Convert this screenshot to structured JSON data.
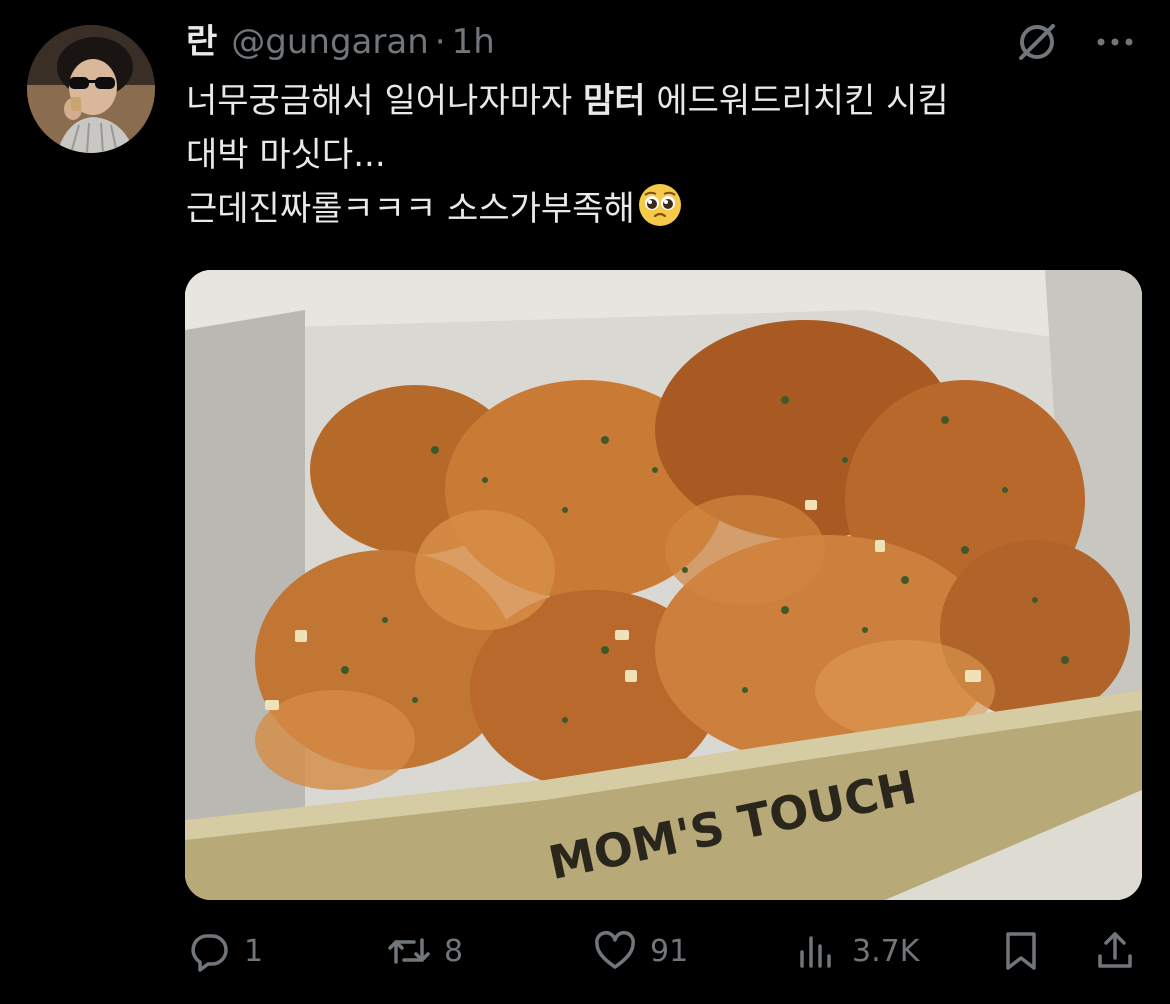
{
  "tweet": {
    "display_name": "란",
    "handle": "@gungaran",
    "separator": "·",
    "time": "1h",
    "text_line1_a": "너무궁금해서 일어나자마자 ",
    "text_line1_bold": "맘터",
    "text_line1_b": " 에드워드리치킨 시킴",
    "text_line2": "대박 마싯다...",
    "text_line3": "근데진짜롤ㅋㅋㅋ 소스가부족해",
    "emoji": "pleading-face-emoji"
  },
  "media": {
    "description_icon": "photo",
    "box_brand_text": "MOM'S TOUCH"
  },
  "actions": {
    "reply_count": "1",
    "retweet_count": "8",
    "like_count": "91",
    "views_count": "3.7K"
  },
  "icons": {
    "grok": "grok-icon",
    "more": "more-icon",
    "reply": "reply-icon",
    "retweet": "retweet-icon",
    "like": "heart-icon",
    "views": "views-icon",
    "bookmark": "bookmark-icon",
    "share": "share-icon"
  },
  "colors": {
    "background": "#000000",
    "text": "#e7e9ea",
    "secondary": "#71767b"
  }
}
